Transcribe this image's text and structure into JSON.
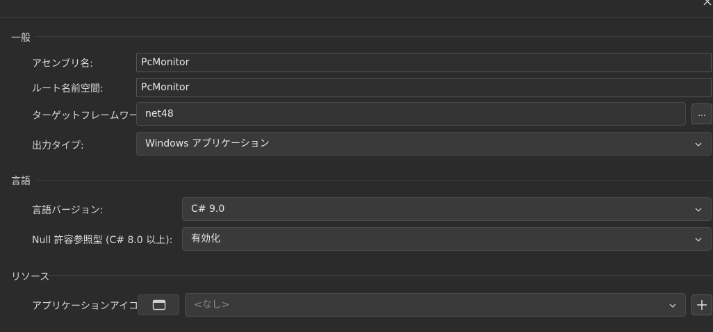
{
  "sections": {
    "general": {
      "title": "一般",
      "assembly_name_label": "アセンブリ名:",
      "assembly_name_value": "PcMonitor",
      "root_namespace_label": "ルート名前空間:",
      "root_namespace_value": "PcMonitor",
      "target_framework_label": "ターゲットフレームワーク:",
      "target_framework_value": "net48",
      "target_framework_browse": "...",
      "output_type_label": "出力タイプ:",
      "output_type_value": "Windows アプリケーション"
    },
    "language": {
      "title": "言語",
      "language_version_label": "言語バージョン:",
      "language_version_value": "C# 9.0",
      "nullable_label": "Null 許容参照型 (C# 8.0 以上):",
      "nullable_value": "有効化"
    },
    "resources": {
      "title": "リソース",
      "app_icon_label": "アプリケーションアイコン:",
      "app_icon_value": "<なし>",
      "add_button": "+"
    }
  },
  "icons": {
    "close": "close-icon",
    "chevron": "chevron-down-icon",
    "window": "window-icon",
    "plus": "plus-icon"
  }
}
